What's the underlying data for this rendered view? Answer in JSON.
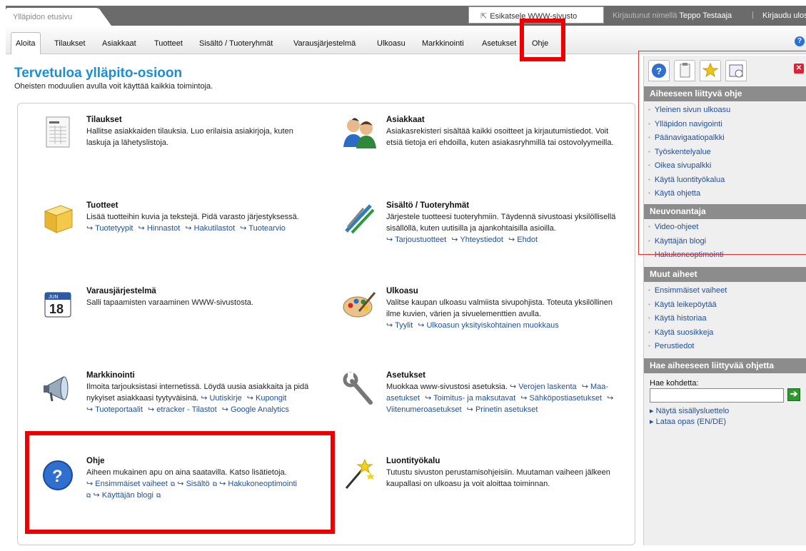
{
  "topbar": {
    "home_tab": "Ylläpidon etusivu",
    "preview_label": "Esikatsele WWW-sivusto",
    "logged_prefix": "Kirjautunut nimellä",
    "user_name": "Teppo Testaaja",
    "separator": "|",
    "logout": "Kirjaudu ulos"
  },
  "nav": {
    "items": [
      "Aloita",
      "Tilaukset",
      "Asiakkaat",
      "Tuotteet",
      "Sisältö / Tuoteryhmät",
      "Varausjärjestelmä",
      "Ulkoasu",
      "Markkinointi",
      "Asetukset",
      "Ohje"
    ],
    "help_icon": "?"
  },
  "main": {
    "title": "Tervetuloa ylläpito-osioon",
    "subtitle": "Oheisten moduulien avulla voit käyttää kaikkia toimintoja."
  },
  "modules": [
    {
      "title": "Tilaukset",
      "desc": "Hallitse asiakkaiden tilauksia. Luo erilaisia asiakirjoja, kuten laskuja ja lähetyslistoja.",
      "links": [],
      "icon": "invoice-document-icon"
    },
    {
      "title": "Asiakkaat",
      "desc": "Asiakasrekisteri sisältää kaikki osoitteet ja kirjautumistiedot. Voit etsiä tietoja eri ehdoilla, kuten asiakasryhmillä tai ostovolyymeilla.",
      "links": [],
      "icon": "customers-people-icon"
    },
    {
      "title": "Tuotteet",
      "desc": "Lisää tuotteihin kuvia ja tekstejä. Pidä varasto järjestyksessä.",
      "links": [
        "Tuotetyypit",
        "Hinnastot",
        "Hakutilastot",
        "Tuotearvio"
      ],
      "icon": "product-box-icon"
    },
    {
      "title": "Sisältö / Tuoteryhmät",
      "desc": "Järjestele tuotteesi tuoteryhmiin. Täydennä sivustoasi yksilöllisellä sisällöllä, kuten uutisilla ja ajankohtaisilla asioilla.",
      "links": [
        "Tarjoustuotteet",
        "Yhteystiedot",
        "Ehdot"
      ],
      "icon": "pens-icon"
    },
    {
      "title": "Varausjärjestelmä",
      "desc": "Salli tapaamisten varaaminen WWW-sivustosta.",
      "links": [],
      "icon": "calendar-icon"
    },
    {
      "title": "Ulkoasu",
      "desc": "Valitse kaupan ulkoasu valmiista sivupohjista. Toteuta yksilöllinen ilme kuvien, värien ja sivuelementtien avulla.",
      "links": [
        "Tyylit",
        "Ulkoasun yksityiskohtainen muokkaus"
      ],
      "icon": "palette-icon"
    },
    {
      "title": "Markkinointi",
      "desc": "Ilmoita tarjouksistasi internetissä. Löydä uusia asiakkaita ja pidä nykyiset asiakkaasi tyytyväisinä.",
      "links": [
        "Uutiskirje",
        "Kupongit",
        "Tuoteportaalit",
        "etracker - Tilastot",
        "Google Analytics"
      ],
      "icon": "megaphone-icon"
    },
    {
      "title": "Asetukset",
      "desc": "Muokkaa www-sivustosi asetuksia.",
      "links": [
        "Verojen laskenta",
        "Maa-asetukset",
        "Toimitus- ja maksutavat",
        "Sähköpostiasetukset",
        "Viitenumeroasetukset",
        "Prinetin asetukset"
      ],
      "icon": "wrench-icon"
    },
    {
      "title": "Ohje",
      "desc": "Aiheen mukainen apu on aina saatavilla. Katso lisätietoja.",
      "links": [
        "Ensimmäiset vaiheet",
        "Sisältö",
        "Hakukoneoptimointi",
        "Käyttäjän blogi"
      ],
      "icon": "help-question-icon"
    },
    {
      "title": "Luontityökalu",
      "desc": "Tutustu sivuston perustamisohjeisiin. Muutaman vaiheen jälkeen kaupallasi on ulkoasu ja voit aloittaa toiminnan.",
      "links": [],
      "icon": "magic-wand-icon"
    }
  ],
  "sidebar": {
    "section1": {
      "title": "Aiheeseen liittyvä ohje",
      "items": [
        "Yleinen sivun ulkoasu",
        "Ylläpidon navigointi",
        "Päänavigaatiopalkki",
        "Työskentelyalue",
        "Oikea sivupalkki",
        "Käytä luontityökalua",
        "Käytä ohjetta"
      ]
    },
    "section2": {
      "title": "Neuvonantaja",
      "items": [
        "Video-ohjeet",
        "Käyttäjän blogi",
        "Hakukoneoptimointi"
      ]
    },
    "section3": {
      "title": "Muut aiheet",
      "items": [
        "Ensimmäiset vaiheet",
        "Käytä leikepöytää",
        "Käytä historiaa",
        "Käytä suosikkeja",
        "Perustiedot"
      ]
    },
    "section4": {
      "title": "Hae aiheeseen liittyvää ohjetta"
    },
    "search_label": "Hae kohdetta:",
    "search_value": "",
    "go_label": "➔",
    "toc_link": "Näytä sisällysluettelo",
    "download_link": "Lataa opas (EN/DE)"
  },
  "colors": {
    "accent": "#1a8fd6",
    "link": "#1f4f9a",
    "highlight": "#ee0000",
    "section_bg": "#8c8c8c"
  }
}
